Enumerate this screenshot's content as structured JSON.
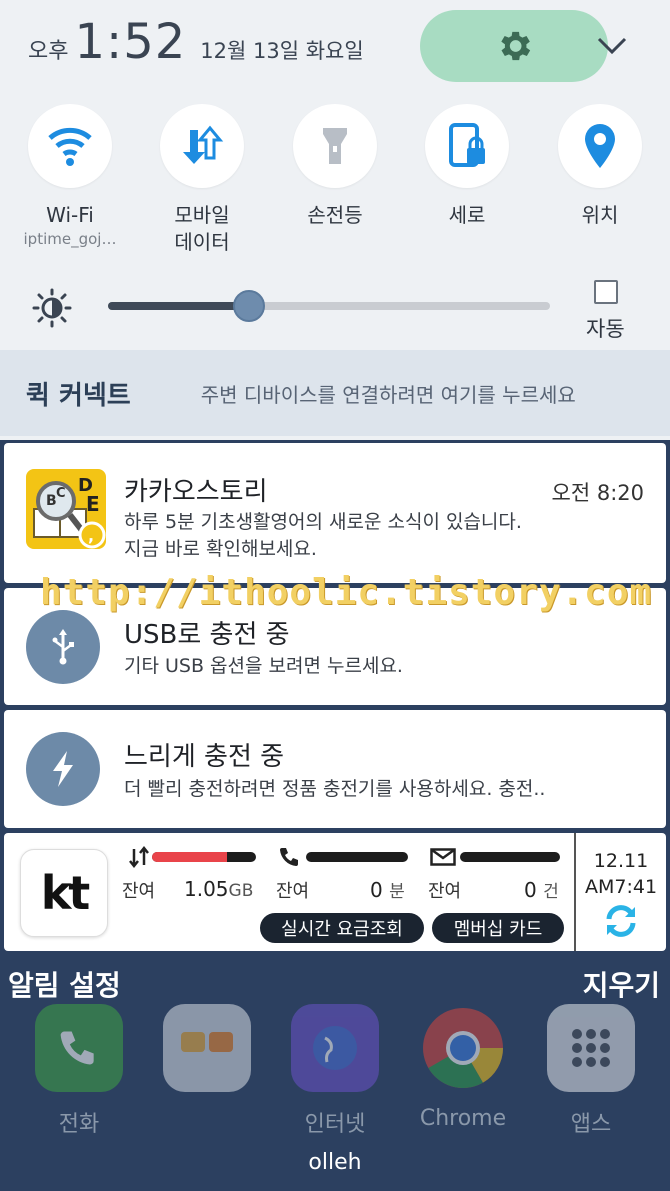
{
  "status": {
    "ampm": "오후",
    "time": "1:52",
    "date": "12월 13일 화요일"
  },
  "colors": {
    "settings_pill": "#a8dcc2",
    "accent_blue": "#1d8ce0",
    "kt_red": "#e9444a"
  },
  "quick_tiles": [
    {
      "label": "Wi-Fi",
      "sub": "iptime_goj…",
      "icon": "wifi-icon"
    },
    {
      "label": "모바일\n데이터",
      "sub": "",
      "icon": "mobile-data-icon"
    },
    {
      "label": "손전등",
      "sub": "",
      "icon": "flashlight-icon"
    },
    {
      "label": "세로",
      "sub": "",
      "icon": "portrait-lock-icon"
    },
    {
      "label": "위치",
      "sub": "",
      "icon": "location-icon"
    }
  ],
  "brightness": {
    "level": 0.32,
    "auto_label": "자동",
    "auto_checked": false
  },
  "quick_connect": {
    "title": "퀵 커넥트",
    "hint": "주변 디바이스를 연결하려면 여기를 누르세요"
  },
  "notifications": [
    {
      "app": "카카오스토리",
      "time": "오전 8:20",
      "line1": "하루 5분 기초생활영어의 새로운 소식이 있습니다.",
      "line2": "지금 바로 확인해보세요."
    },
    {
      "title": "USB로 충전 중",
      "body": "기타 USB 옵션을 보려면 누르세요."
    },
    {
      "title": "느리게 충전 중",
      "body": "더 빨리 충전하려면 정품 충전기를 사용하세요. 충전.."
    }
  ],
  "watermark": "http://ithoolic.tistory.com",
  "kt": {
    "logo_text": "kt",
    "data": {
      "label": "잔여",
      "value": "1.05",
      "unit": "GB",
      "fill": 0.72
    },
    "voice": {
      "label": "잔여",
      "value": "0",
      "unit": "분"
    },
    "sms": {
      "label": "잔여",
      "value": "0",
      "unit": "건"
    },
    "btn_realtime": "실시간 요금조회",
    "btn_membership": "멤버십 카드",
    "date": "12.11",
    "time": "AM7:41"
  },
  "footer": {
    "settings": "알림 설정",
    "clear": "지우기"
  },
  "dock": [
    {
      "label": "전화",
      "icon": "phone-icon"
    },
    {
      "label": "",
      "icon": "folder-icon"
    },
    {
      "label": "인터넷",
      "icon": "internet-icon"
    },
    {
      "label": "Chrome",
      "icon": "chrome-icon"
    },
    {
      "label": "앱스",
      "icon": "apps-icon"
    }
  ],
  "carrier": "olleh"
}
